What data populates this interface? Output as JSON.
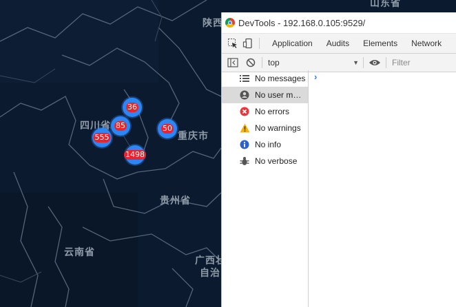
{
  "map": {
    "labels": {
      "shandong": "山东省",
      "shaanxi": "陕西",
      "sichuan": "四川省",
      "chongqing": "重庆市",
      "guizhou": "贵州省",
      "yunnan": "云南省",
      "guangxi_1": "广西壮",
      "guangxi_2": "自治"
    },
    "clusters": {
      "c36": "36",
      "c85": "85",
      "c555": "555",
      "c1498": "1498",
      "c50": "50"
    },
    "colors": {
      "background": "#0b1a2e",
      "cluster": "#2d86f5",
      "badge": "#e8252e"
    }
  },
  "devtools": {
    "title": "DevTools - 192.168.0.105:9529/",
    "tabs": [
      "Application",
      "Audits",
      "Elements",
      "Network"
    ],
    "context": "top",
    "filter_placeholder": "Filter",
    "sidebar": [
      {
        "label": "No messages",
        "icon": "list-icon"
      },
      {
        "label": "No user messages",
        "icon": "user-icon",
        "selected": true
      },
      {
        "label": "No errors",
        "icon": "error-icon"
      },
      {
        "label": "No warnings",
        "icon": "warning-icon"
      },
      {
        "label": "No info",
        "icon": "info-icon"
      },
      {
        "label": "No verbose",
        "icon": "bug-icon"
      }
    ]
  }
}
